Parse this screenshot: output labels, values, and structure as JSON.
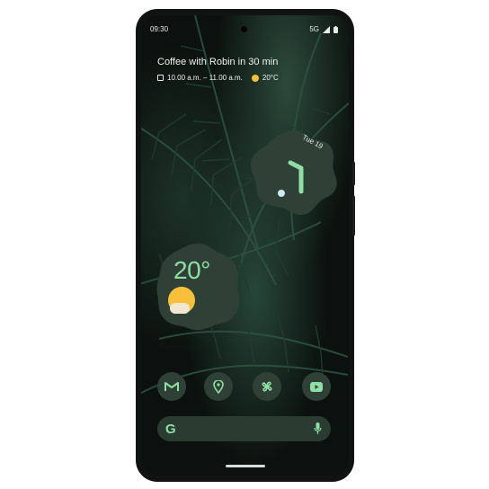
{
  "status_bar": {
    "time": "09:30",
    "network": "5G"
  },
  "event": {
    "title": "Coffee with Robin in 30 min",
    "time_range": "10.00 a.m. – 11.00 a.m.",
    "temp": "20°C"
  },
  "clock": {
    "date": "Tue 19"
  },
  "weather": {
    "temp": "20°"
  },
  "dock": {
    "apps": [
      "gmail-icon",
      "maps-icon",
      "pinwheel-icon",
      "youtube-icon"
    ]
  },
  "search": {
    "logo": "G"
  },
  "colors": {
    "accent": "#8fdfa5",
    "widget_bg": "#2f4136",
    "sun": "#f4c13b"
  }
}
